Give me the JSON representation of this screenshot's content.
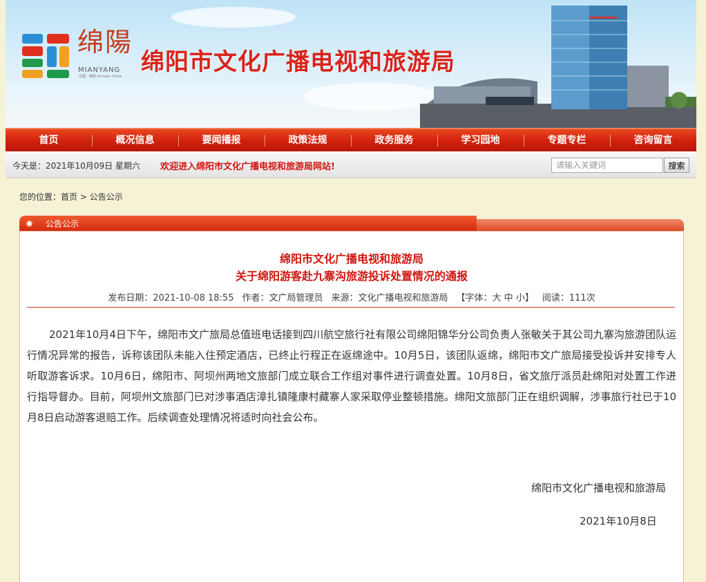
{
  "logo": {
    "chinese": "绵陽",
    "english": "MIANYANG",
    "sub": "中国 · 绵阳 Sichuan China"
  },
  "header": {
    "site_title": "绵阳市文化广播电视和旅游局"
  },
  "nav": {
    "items": [
      "首页",
      "概况信息",
      "要闻播报",
      "政策法规",
      "政务服务",
      "学习园地",
      "专题专栏",
      "咨询留言"
    ]
  },
  "infobar": {
    "today": "今天是：2021年10月09日 星期六",
    "welcome": "欢迎进入绵阳市文化广播电视和旅游局网站!",
    "search_placeholder": "请输入关键词",
    "search_button": "搜索"
  },
  "breadcrumb": {
    "prefix": "您的位置：",
    "home": "首页",
    "sep": " > ",
    "current": "公告公示"
  },
  "column": {
    "label": "公告公示"
  },
  "article": {
    "title_line1": "绵阳市文化广播电视和旅游局",
    "title_line2": "关于绵阳游客赴九寨沟旅游投诉处置情况的通报",
    "meta": {
      "date": "发布日期：2021-10-08 18:55",
      "author": "作者：文广局管理员",
      "source": "来源：文化广播电视和旅游局",
      "font_prefix": "【字体：",
      "font_large": "大",
      "font_medium": "中",
      "font_small": "小",
      "font_suffix": "】",
      "views": "阅读：111次"
    },
    "body": "2021年10月4日下午，绵阳市文广旅局总值班电话接到四川航空旅行社有限公司绵阳锦华分公司负责人张敏关于其公司九寨沟旅游团队运行情况异常的报告，诉称该团队未能入住预定酒店，已终止行程正在返绵途中。10月5日，该团队返绵，绵阳市文广旅局接受投诉并安排专人听取游客诉求。10月6日，绵阳市、阿坝州两地文旅部门成立联合工作组对事件进行调查处置。10月8日，省文旅厅派员赴绵阳对处置工作进行指导督办。目前，阿坝州文旅部门已对涉事酒店漳扎镇隆康村藏寨人家采取停业整顿措施。绵阳文旅部门正在组织调解，涉事旅行社已于10月8日启动游客退赔工作。后续调查处理情况将适时向社会公布。",
    "sign_org": "绵阳市文化广播电视和旅游局",
    "sign_date": "2021年10月8日"
  }
}
